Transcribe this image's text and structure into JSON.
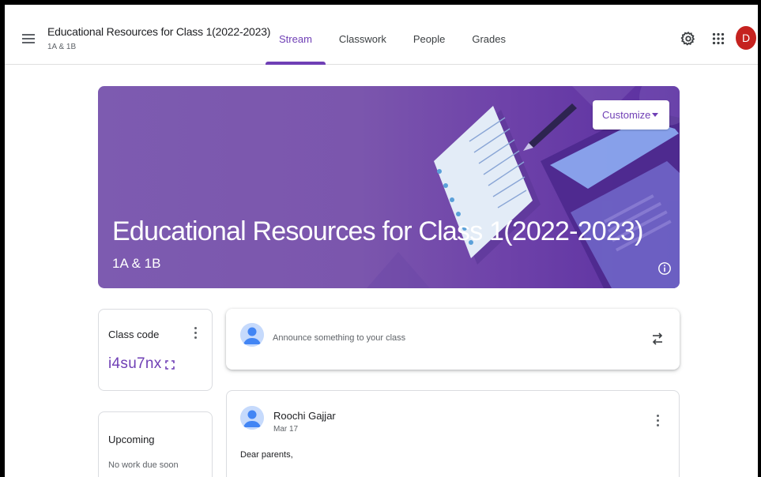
{
  "header": {
    "class_title": "Educational Resources for Class 1(2022-2023)",
    "class_subtitle": "1A & 1B",
    "tabs": [
      {
        "label": "Stream",
        "active": true
      },
      {
        "label": "Classwork",
        "active": false
      },
      {
        "label": "People",
        "active": false
      },
      {
        "label": "Grades",
        "active": false
      }
    ],
    "avatar_letter": "D",
    "icons": [
      "menu-icon",
      "settings-icon",
      "apps-grid-icon"
    ]
  },
  "banner": {
    "title": "Educational Resources for Class 1(2022-2023)",
    "subtitle": "1A & 1B",
    "customize_label": "Customize",
    "info_icon": "info-icon"
  },
  "class_code": {
    "label": "Class code",
    "value": "i4su7nx"
  },
  "upcoming": {
    "label": "Upcoming",
    "note": "No work due soon"
  },
  "announce": {
    "placeholder": "Announce something to your class"
  },
  "post": {
    "author": "Roochi Gajjar",
    "date": "Mar 17",
    "body": "Dear parents,"
  },
  "colors": {
    "accent": "#6f3fb5",
    "banner": "#7d5bb0",
    "avatar_red": "#c5221f"
  }
}
